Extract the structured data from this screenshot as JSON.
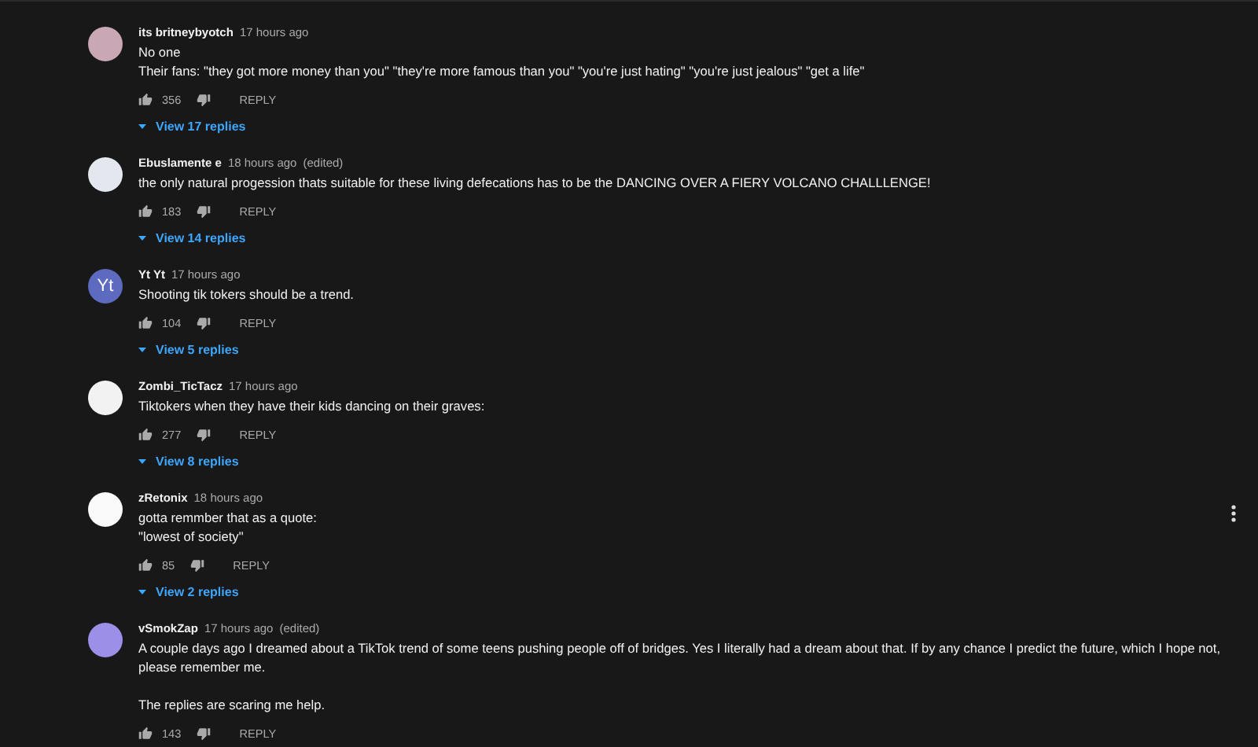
{
  "comments": [
    {
      "author": "its britneybyotch",
      "time": "17 hours ago",
      "avatar": {
        "kind": "image",
        "color": "#c9a7b4"
      },
      "body": [
        [
          "No one",
          "Their fans: \"they got more money than you\" \"they're  more famous than you\" \"you're just hating\" \"you're just jealous\" \"get a life\""
        ]
      ],
      "likes": "356",
      "reply": "REPLY",
      "replies": "View 17 replies",
      "menu": false
    },
    {
      "author": "Ebuslamente e",
      "time": "18 hours ago",
      "edited": "(edited)",
      "avatar": {
        "kind": "image",
        "color": "#e4e8ee"
      },
      "body": [
        [
          "the only natural progession thats suitable for these living defecations has to be the DANCING OVER A FIERY VOLCANO CHALLLENGE!"
        ]
      ],
      "likes": "183",
      "reply": "REPLY",
      "replies": "View 14 replies",
      "menu": false
    },
    {
      "author": "Yt Yt",
      "time": "17 hours ago",
      "avatar": {
        "kind": "letter",
        "text": "Yt",
        "color": "#5c6bc0"
      },
      "body": [
        [
          "Shooting tik tokers should be a trend."
        ]
      ],
      "likes": "104",
      "reply": "REPLY",
      "replies": "View 5 replies",
      "menu": false
    },
    {
      "author": "Zombi_TicTacz",
      "time": "17 hours ago",
      "avatar": {
        "kind": "image",
        "color": "#f2f2f2"
      },
      "body": [
        [
          "Tiktokers when they have their kids dancing on their graves:"
        ]
      ],
      "likes": "277",
      "reply": "REPLY",
      "replies": "View 8 replies",
      "menu": false
    },
    {
      "author": "zRetonix",
      "time": "18 hours ago",
      "avatar": {
        "kind": "image",
        "color": "#fafafa"
      },
      "body": [
        [
          "gotta remmber that as a quote:",
          "\"lowest of society\""
        ]
      ],
      "likes": "85",
      "reply": "REPLY",
      "replies": "View 2 replies",
      "menu": true
    },
    {
      "author": "vSmokZap",
      "time": "17 hours ago",
      "edited": "(edited)",
      "avatar": {
        "kind": "image",
        "color": "#9b8fe8"
      },
      "body": [
        [
          "A couple days ago I dreamed about a TikTok trend of some teens pushing people off of bridges. Yes I literally had a dream about that. If by any chance I predict the future, which I hope not, please remember me."
        ],
        [
          "The replies are scaring me help."
        ]
      ],
      "likes": "143",
      "reply": "REPLY",
      "menu": false
    }
  ]
}
